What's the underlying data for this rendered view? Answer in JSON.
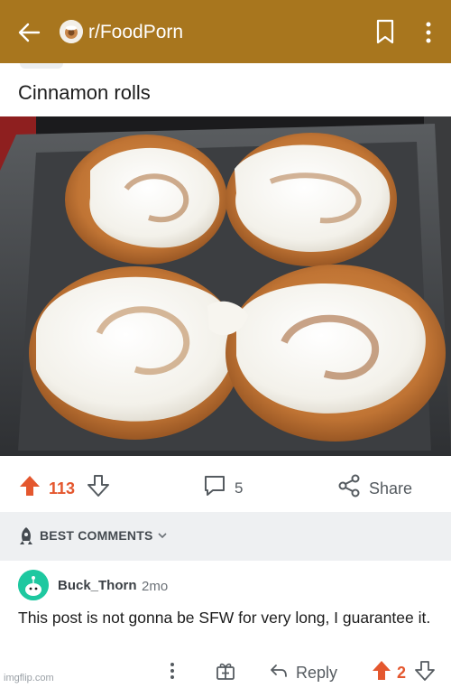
{
  "header": {
    "back_icon": "arrow-left-icon",
    "subreddit": "r/FoodPorn",
    "bookmark_icon": "bookmark-icon",
    "more_icon": "vertical-dots-icon",
    "bar_color": "#a8761e"
  },
  "post": {
    "title": "Cinnamon rolls",
    "image_icon": "cinnamon-rolls-photo"
  },
  "actions": {
    "upvotes": "113",
    "comments": "5",
    "share_label": "Share",
    "accent": "#e4572e"
  },
  "sort": {
    "label": "BEST COMMENTS"
  },
  "comment": {
    "username": "Buck_Thorn",
    "time": "2mo",
    "body": "This post is not gonna be SFW for very long, I guarantee it.",
    "reply_label": "Reply",
    "score": "2"
  },
  "watermark": "imgflip.com"
}
